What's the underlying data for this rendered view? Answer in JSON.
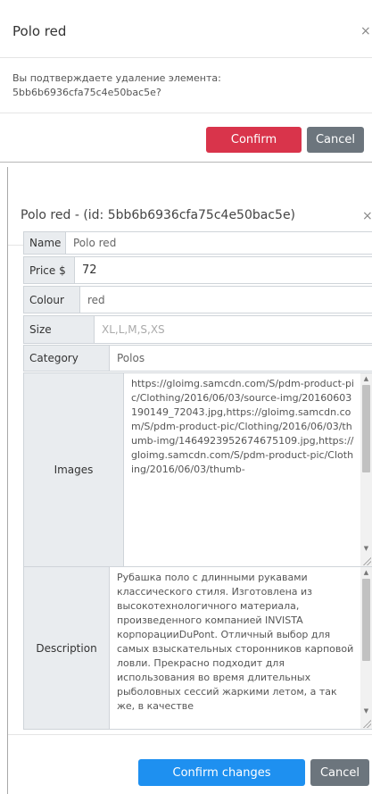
{
  "delete_dialog": {
    "title": "Polo red",
    "close": "×",
    "message": "Вы подтверждаете удаление элемента: 5bb6b6936cfa75c4e50bac5e?",
    "confirm_label": "Confirm",
    "cancel_label": "Cancel"
  },
  "edit_dialog": {
    "title": "Polo red - (id: 5bb6b6936cfa75c4e50bac5e)",
    "close": "×",
    "fields": {
      "name": {
        "label": "Name",
        "value": "Polo red"
      },
      "price": {
        "label": "Price $",
        "value": "72"
      },
      "colour": {
        "label": "Colour",
        "value": "red"
      },
      "size": {
        "label": "Size",
        "placeholder": "XL,L,M,S,XS"
      },
      "category": {
        "label": "Category",
        "value": "Polos"
      },
      "images": {
        "label": "Images",
        "value": "https://gloimg.samcdn.com/S/pdm-product-pic/Clothing/2016/06/03/source-img/20160603190149_72043.jpg,https://gloimg.samcdn.com/S/pdm-product-pic/Clothing/2016/06/03/thumb-img/1464923952674675109.jpg,https://gloimg.samcdn.com/S/pdm-product-pic/Clothing/2016/06/03/thumb-"
      },
      "description": {
        "label": "Description",
        "value": "Рубашка поло с длинными рукавами классического стиля. Изготовлена из высокотехнологичного материала, произведенного компанией INVISTA корпорацииDuPont. Отличный выбор для самых взыскательных сторонников карповой ловли. Прекрасно подходит для использования во время длительных рыболовных сессий жаркими летом, а так же, в качестве"
      }
    },
    "confirm_label": "Confirm changes",
    "cancel_label": "Cancel"
  },
  "colors": {
    "danger": "#d9344b",
    "primary": "#1e90f0",
    "secondary": "#6c757d"
  },
  "icons": {
    "close": "close-icon",
    "resize": "resize-grip-icon",
    "scroll_up": "scroll-up-arrow-icon",
    "scroll_down": "scroll-down-arrow-icon"
  }
}
